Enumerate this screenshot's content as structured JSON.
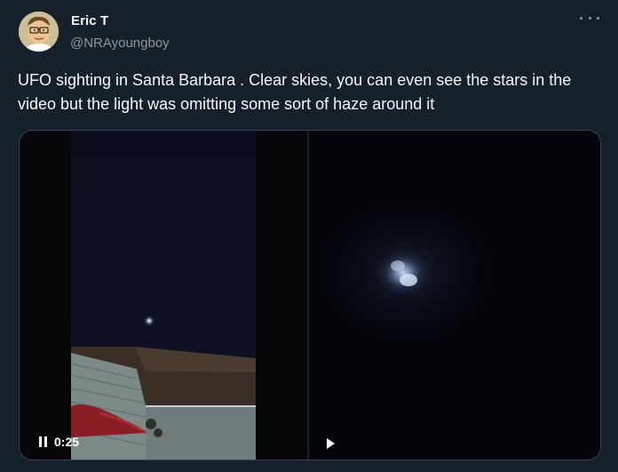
{
  "author": {
    "name": "Eric T",
    "handle": "@NRAyoungboy",
    "avatar_icon": "cartoon-avatar"
  },
  "tweet": {
    "text": "UFO sighting in Santa Barbara . Clear skies, you can even see the stars in the video but the light was omitting some sort of haze around it"
  },
  "media": {
    "videos": [
      {
        "state": "playing",
        "timestamp": "0:25"
      },
      {
        "state": "paused",
        "timestamp": ""
      }
    ]
  },
  "icons": {
    "more": "more-options-icon",
    "pause": "pause-icon",
    "play": "play-icon"
  },
  "colors": {
    "background": "#15202b",
    "text_primary": "#f7f9f9",
    "text_secondary": "#8b98a5",
    "border": "#38444d"
  }
}
